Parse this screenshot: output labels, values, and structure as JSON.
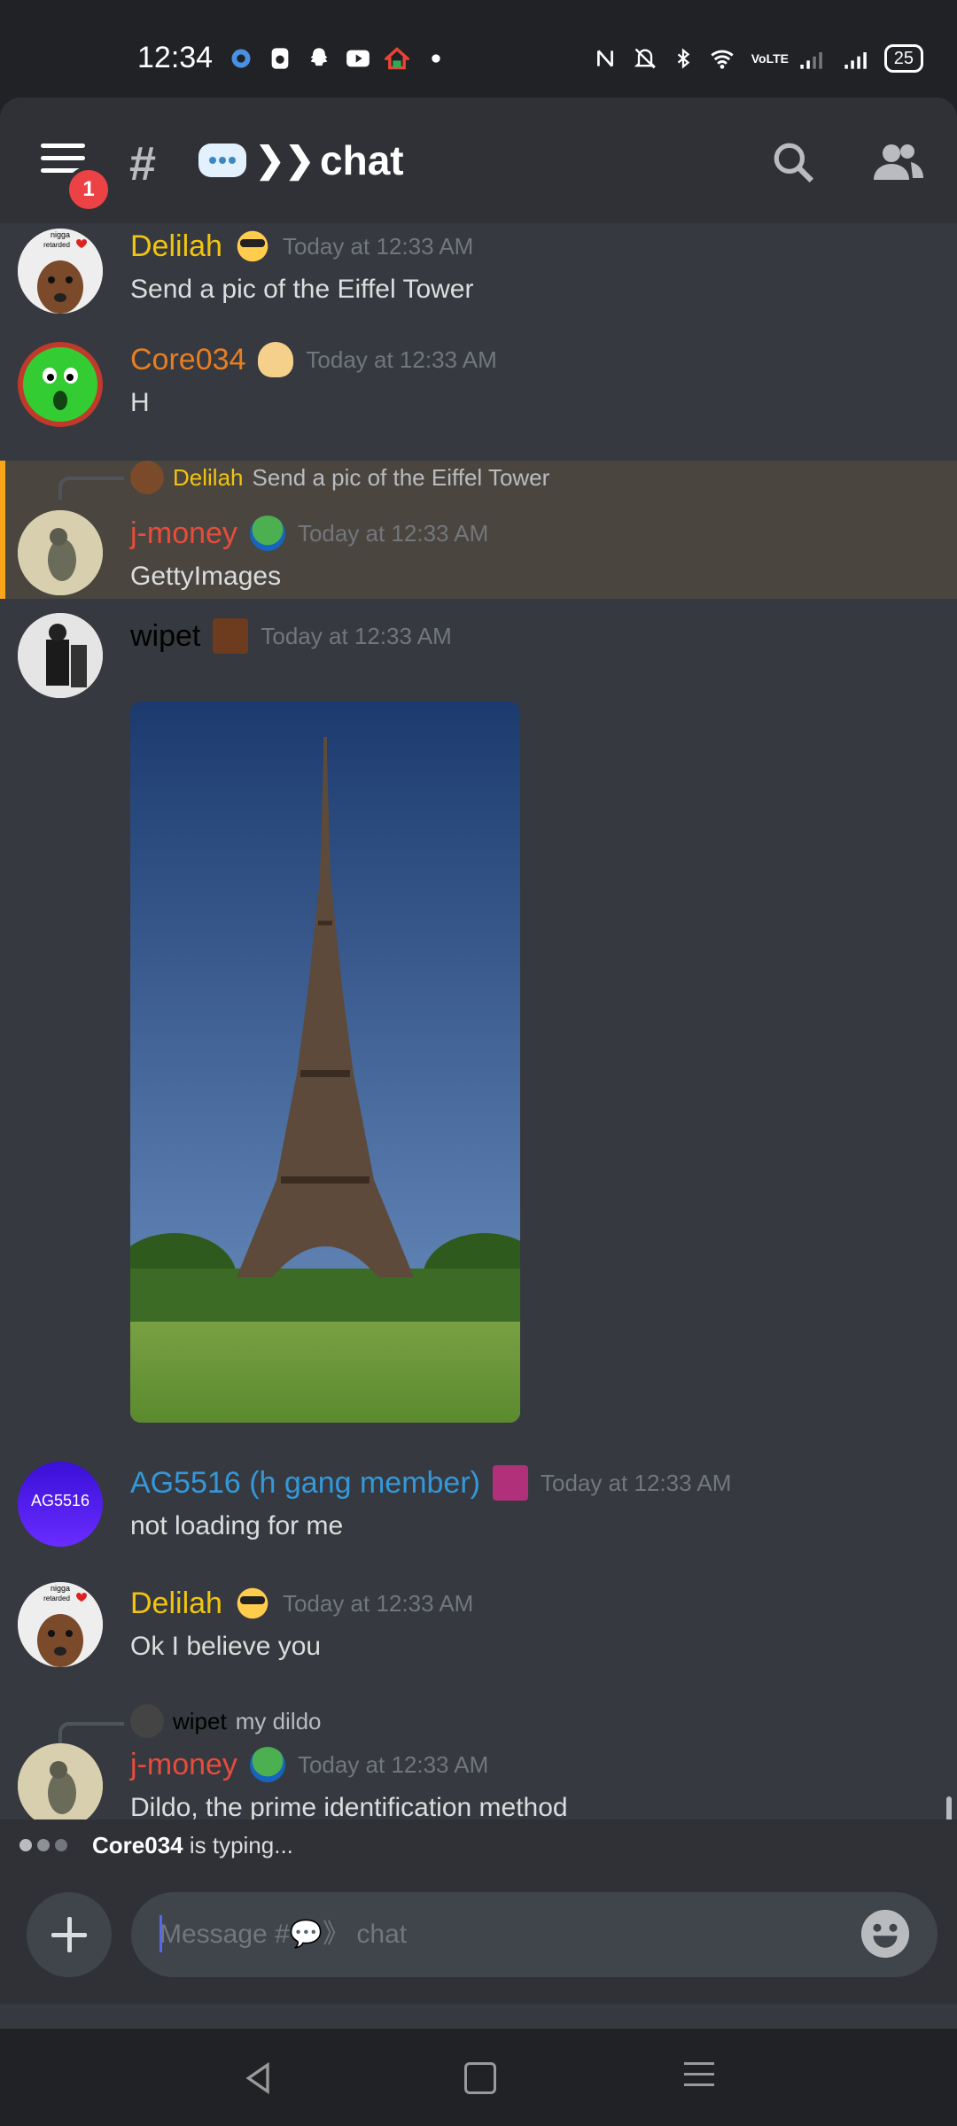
{
  "status_bar": {
    "time": "12:34",
    "battery": "25",
    "network": "VoLTE"
  },
  "header": {
    "notification_count": "1",
    "channel_name": "chat",
    "hash": "#"
  },
  "messages": [
    {
      "author": "Delilah",
      "author_color": "#f1c40f",
      "timestamp": "Today at 12:33 AM",
      "text": "Send a pic of the Eiffel Tower",
      "avatar_label_top": "nigga",
      "avatar_label_bottom": "retarded"
    },
    {
      "author": "Core034",
      "author_color": "#e67e22",
      "timestamp": "Today at 12:33 AM",
      "text": "H"
    },
    {
      "author": "j-money",
      "author_color": "#e74c3c",
      "timestamp": "Today at 12:33 AM",
      "text": "GettyImages",
      "reply": {
        "author": "Delilah",
        "author_color": "#f1c40f",
        "text": "Send a pic of the Eiffel Tower"
      }
    },
    {
      "author": "wipet",
      "author_color": "#000000",
      "timestamp": "Today at 12:33 AM",
      "text": ""
    },
    {
      "author": "AG5516 (h gang member)",
      "author_color": "#3498db",
      "timestamp": "Today at 12:33 AM",
      "text": "not loading for me",
      "avatar_text": "AG5516"
    },
    {
      "author": "Delilah",
      "author_color": "#f1c40f",
      "timestamp": "Today at 12:33 AM",
      "text": "Ok I believe you",
      "avatar_label_top": "nigga",
      "avatar_label_bottom": "retarded"
    },
    {
      "author": "j-money",
      "author_color": "#e74c3c",
      "timestamp": "Today at 12:33 AM",
      "text": "Dildo, the prime identification method",
      "reply": {
        "author": "wipet",
        "author_color": "#000000",
        "text": "my dildo"
      }
    }
  ],
  "typing": {
    "user": "Core034",
    "suffix": " is typing..."
  },
  "composer": {
    "placeholder": "Message #💬》 chat"
  }
}
